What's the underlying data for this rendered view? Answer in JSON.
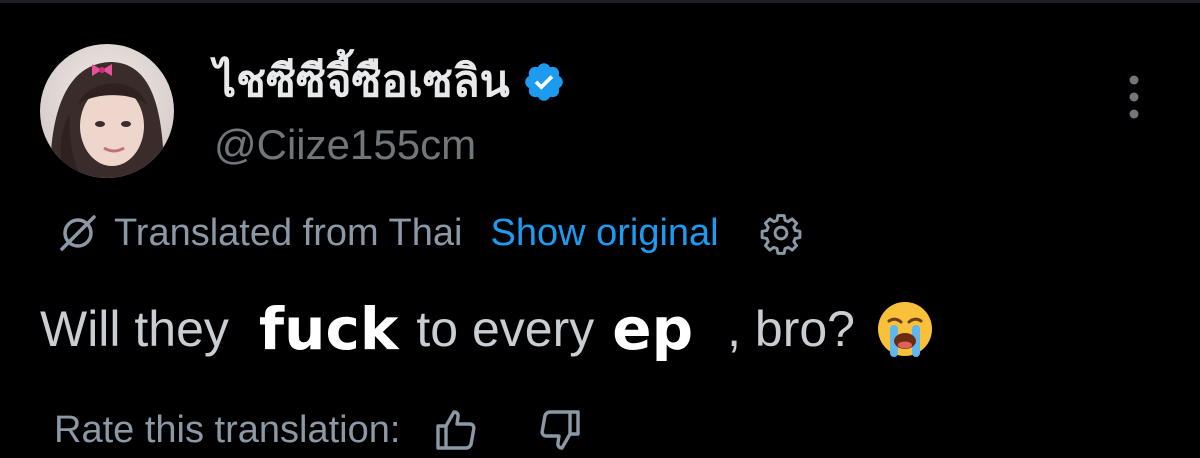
{
  "profile": {
    "display_name": "ไชซีซีจี้ซือเซลิน",
    "handle": "@Ciize155cm",
    "verified_icon": "verified-badge-icon",
    "more_icon": "vertical-ellipsis-icon"
  },
  "translation_bar": {
    "label": "Translated from Thai",
    "show_original": "Show original",
    "icon": "translate-slash-icon",
    "settings_icon": "gear-icon"
  },
  "tweet": {
    "part1": "Will they",
    "overlay1": "fuck",
    "part2": "to every",
    "overlay2": "ep",
    "part3": ", bro?",
    "emoji": "loudly-crying-face-emoji"
  },
  "rating": {
    "label": "Rate this translation:",
    "up_icon": "thumbs-up-icon",
    "down_icon": "thumbs-down-icon"
  },
  "colors": {
    "background": "#000000",
    "primary_text": "#e7e9ea",
    "secondary_text": "#71767b",
    "link": "#1d9bf0",
    "verified": "#1d9bf0"
  }
}
